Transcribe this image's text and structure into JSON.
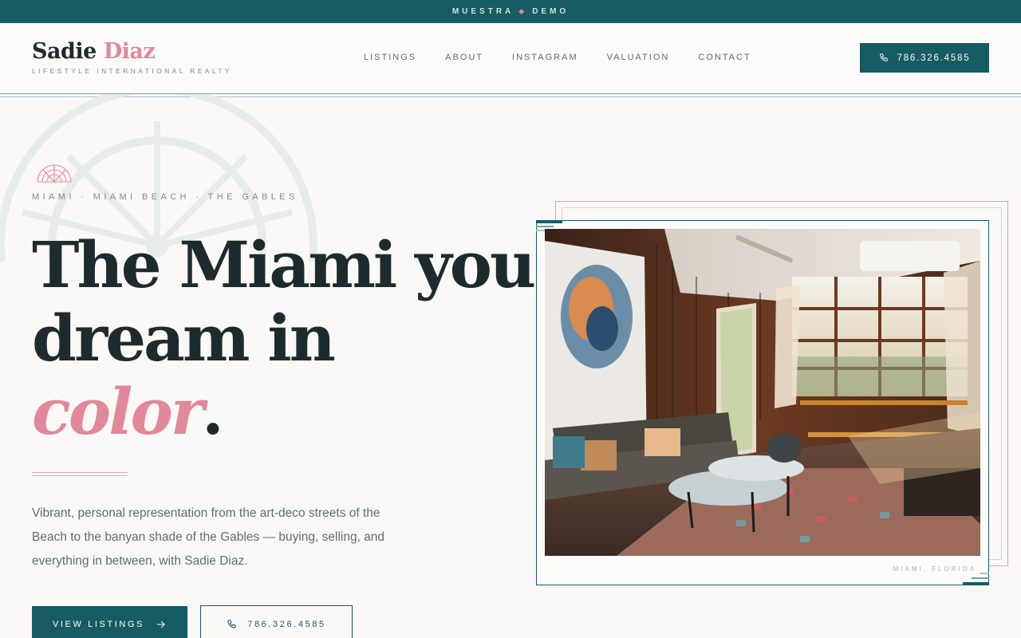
{
  "topbar": {
    "left_text": "MUESTRA",
    "diamond": "◆",
    "right_text": "DEMO"
  },
  "brand": {
    "first_name": "Sadie",
    "last_name": "Diaz",
    "subtitle": "LIFESTYLE INTERNATIONAL REALTY"
  },
  "nav": {
    "items": [
      {
        "label": "LISTINGS"
      },
      {
        "label": "ABOUT"
      },
      {
        "label": "INSTAGRAM"
      },
      {
        "label": "VALUATION"
      },
      {
        "label": "CONTACT"
      }
    ]
  },
  "header_phone": {
    "label": "786.326.4585",
    "icon": "phone-icon"
  },
  "hero": {
    "eyebrow": "MIAMI · MIAMI BEACH · THE GABLES",
    "headline_line1": "The Miami you",
    "headline_line2": "dream in",
    "headline_accent": "color",
    "headline_dot": ".",
    "lede": "Vibrant, personal representation from the art-deco streets of the Beach to the banyan shade of the Gables — buying, selling, and everything in between, with Sadie Diaz.",
    "primary_button": "VIEW LISTINGS",
    "secondary_button": "786.326.4585",
    "photo_caption": "MIAMI, FLORIDA"
  },
  "colors": {
    "teal": "#175b63",
    "pink": "#e3889a",
    "ink": "#1e2b2e",
    "background": "#fbf9f7"
  },
  "icons": {
    "sun": "sunburst-icon",
    "arrow": "arrow-right-icon",
    "phone": "phone-icon"
  }
}
